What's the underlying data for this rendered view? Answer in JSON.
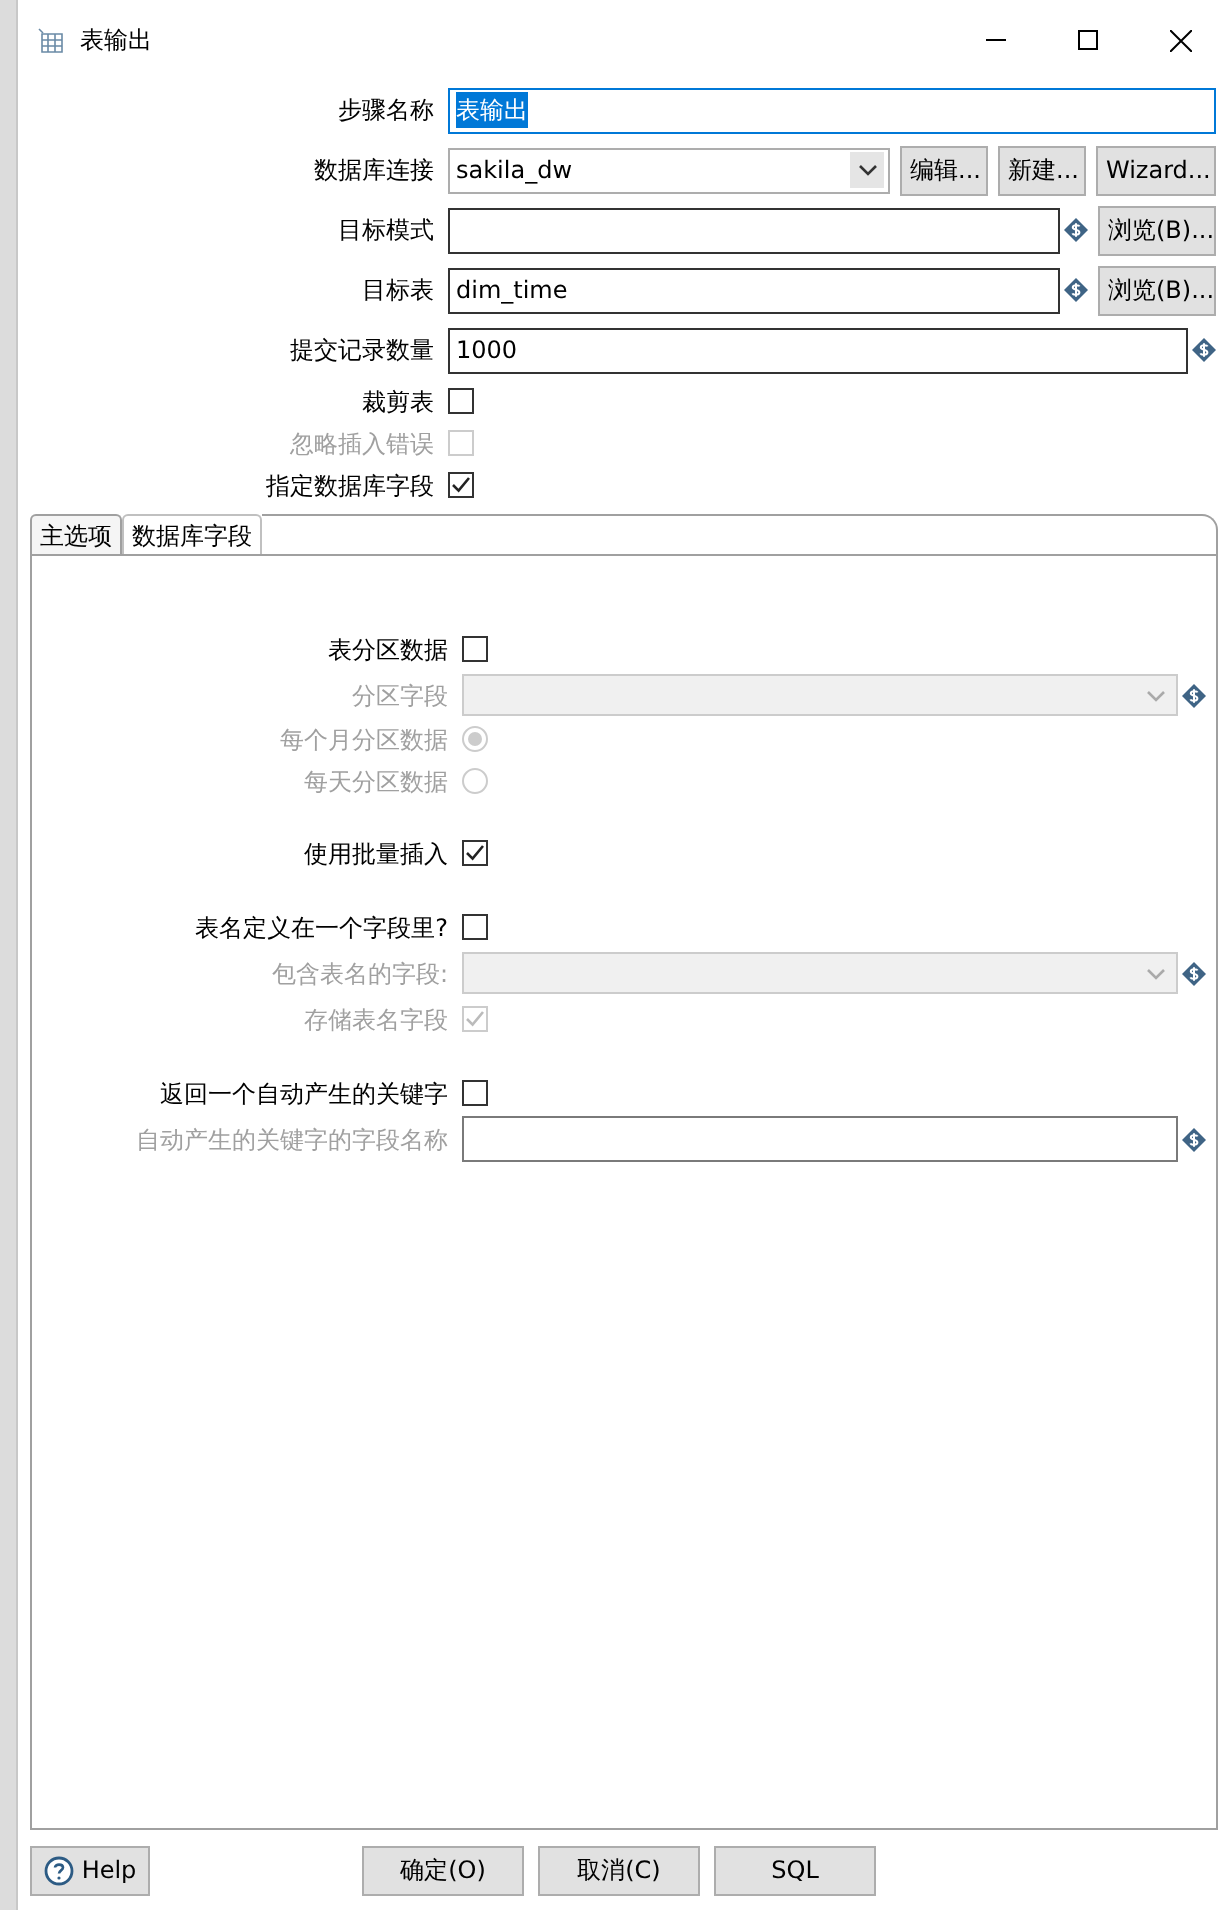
{
  "window": {
    "title": "表输出"
  },
  "fields": [
    {
      "kind": "text",
      "label": "步骤名称",
      "value": "表输出",
      "value_selected": true,
      "focused": true,
      "variable": false
    },
    {
      "kind": "select",
      "label": "数据库连接",
      "value": "sakila_dw",
      "buttons": [
        "编辑...",
        "新建...",
        "Wizard..."
      ]
    },
    {
      "kind": "text",
      "label": "目标模式",
      "focused": false,
      "variable": true,
      "buttons": [
        "浏览(B)..."
      ]
    },
    {
      "kind": "text",
      "label": "目标表",
      "value": "dim_time",
      "value_selected": false,
      "focused": false,
      "variable": true,
      "buttons": [
        "浏览(B)..."
      ]
    },
    {
      "kind": "text",
      "label": "提交记录数量",
      "value": "1000",
      "value_selected": false,
      "focused": false,
      "variable": true
    },
    {
      "kind": "checkbox",
      "label": "裁剪表",
      "checked": false,
      "disabled": false
    },
    {
      "kind": "checkbox",
      "label": "忽略插入错误",
      "checked": false,
      "disabled": true
    },
    {
      "kind": "checkbox",
      "label": "指定数据库字段",
      "checked": true,
      "disabled": false
    }
  ],
  "tabs": [
    {
      "label": "主选项",
      "selected": true
    },
    {
      "label": "数据库字段",
      "selected": false
    }
  ],
  "option_groups": [
    [
      {
        "kind": "checkbox",
        "label": "表分区数据",
        "checked": false,
        "disabled": false
      },
      {
        "kind": "select",
        "label": "分区字段",
        "disabled": true,
        "variable": true
      },
      {
        "kind": "radio",
        "label": "每个月分区数据",
        "selected": true,
        "disabled": true
      },
      {
        "kind": "radio",
        "label": "每天分区数据",
        "selected": false,
        "disabled": true
      }
    ],
    [
      {
        "kind": "checkbox",
        "label": "使用批量插入",
        "checked": true,
        "disabled": false
      }
    ],
    [
      {
        "kind": "checkbox",
        "label": "表名定义在一个字段里?",
        "checked": false,
        "disabled": false
      },
      {
        "kind": "select",
        "label": "包含表名的字段:",
        "disabled": true,
        "variable": true
      },
      {
        "kind": "checkbox",
        "label": "存储表名字段",
        "checked": true,
        "disabled": true
      }
    ],
    [
      {
        "kind": "checkbox",
        "label": "返回一个自动产生的关键字",
        "checked": false,
        "disabled": false
      },
      {
        "kind": "text",
        "label": "自动产生的关键字的字段名称",
        "disabled": true,
        "variable": true
      }
    ]
  ],
  "footer": {
    "help": "Help",
    "buttons": [
      "确定(O)",
      "取消(C)",
      "SQL"
    ]
  }
}
